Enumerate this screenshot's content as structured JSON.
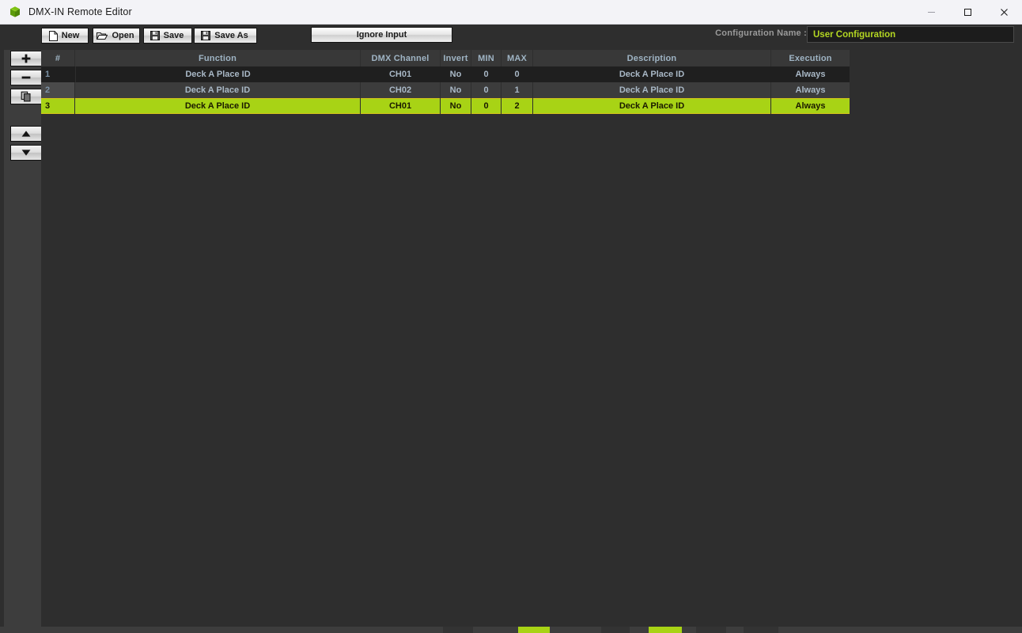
{
  "window": {
    "title": "DMX-IN Remote Editor",
    "app_icon": "green-cube-icon",
    "controls": {
      "minimize": "minimize-icon",
      "maximize": "maximize-icon",
      "close": "close-icon"
    }
  },
  "toolbar": {
    "new_label": "New",
    "open_label": "Open",
    "save_label": "Save",
    "save_as_label": "Save As",
    "ignore_input_label": "Ignore Input",
    "config_name_label": "Configuration Name :",
    "config_name_value": "User Configuration"
  },
  "sidebar": {
    "add_icon": "plus-icon",
    "remove_icon": "minus-icon",
    "duplicate_icon": "copy-pages-icon",
    "move_up_icon": "triangle-up-icon",
    "move_down_icon": "triangle-down-icon"
  },
  "table": {
    "columns": [
      {
        "key": "num",
        "label": "#"
      },
      {
        "key": "func",
        "label": "Function"
      },
      {
        "key": "dmx",
        "label": "DMX Channel"
      },
      {
        "key": "inv",
        "label": "Invert"
      },
      {
        "key": "min",
        "label": "MIN"
      },
      {
        "key": "max",
        "label": "MAX"
      },
      {
        "key": "desc",
        "label": "Description"
      },
      {
        "key": "exec",
        "label": "Execution"
      }
    ],
    "rows": [
      {
        "num": "1",
        "func": "Deck A Place ID",
        "dmx": "CH01",
        "inv": "No",
        "min": "0",
        "max": "0",
        "desc": "Deck A Place ID",
        "exec": "Always",
        "selected": false
      },
      {
        "num": "2",
        "func": "Deck A Place ID",
        "dmx": "CH02",
        "inv": "No",
        "min": "0",
        "max": "1",
        "desc": "Deck A Place ID",
        "exec": "Always",
        "selected": false
      },
      {
        "num": "3",
        "func": "Deck A Place ID",
        "dmx": "CH01",
        "inv": "No",
        "min": "0",
        "max": "2",
        "desc": "Deck A Place ID",
        "exec": "Always",
        "selected": true
      }
    ]
  },
  "colors": {
    "highlight_green": "#a8d315",
    "accent_text_green": "#b3d622",
    "header_text": "#9fb4c4",
    "row_text": "#a9b8c6",
    "panel_bg": "#2e2e2e",
    "sidebar_bg": "#3d3d3d",
    "titlebar_bg": "#f3f3f7"
  }
}
